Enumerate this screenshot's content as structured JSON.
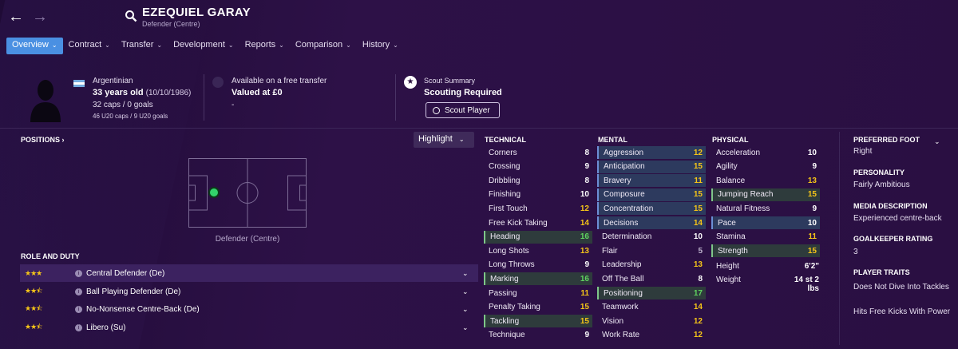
{
  "header": {
    "name": "EZEQUIEL GARAY",
    "position": "Defender (Centre)"
  },
  "tabs": [
    {
      "label": "Overview",
      "active": true
    },
    {
      "label": "Contract"
    },
    {
      "label": "Transfer"
    },
    {
      "label": "Development"
    },
    {
      "label": "Reports"
    },
    {
      "label": "Comparison"
    },
    {
      "label": "History"
    }
  ],
  "info": {
    "nationality": "Argentinian",
    "age": "33 years old",
    "dob": "(10/10/1986)",
    "caps": "32 caps / 0 goals",
    "u20_caps": "46 U20 caps / 9 U20 goals",
    "transfer_status": "Available on a free transfer",
    "value": "Valued at £0",
    "transfer_extra": "-",
    "scout_summary_label": "Scout Summary",
    "scout_summary": "Scouting Required",
    "scout_button": "Scout Player"
  },
  "positions": {
    "title": "POSITIONS",
    "highlight_label": "Highlight",
    "pitch_label": "Defender (Centre)"
  },
  "roles": {
    "title": "ROLE AND DUTY",
    "items": [
      {
        "stars": "★★★",
        "name": "Central Defender (De)",
        "selected": true
      },
      {
        "stars": "★★⯪",
        "name": "Ball Playing Defender (De)"
      },
      {
        "stars": "★★⯪",
        "name": "No-Nonsense Centre-Back (De)"
      },
      {
        "stars": "★★⯪",
        "name": "Libero (Su)"
      }
    ]
  },
  "attributes": {
    "technical_title": "TECHNICAL",
    "mental_title": "MENTAL",
    "physical_title": "PHYSICAL",
    "technical": [
      {
        "name": "Corners",
        "value": "8",
        "color": "white"
      },
      {
        "name": "Crossing",
        "value": "9",
        "color": "white"
      },
      {
        "name": "Dribbling",
        "value": "8",
        "color": "white"
      },
      {
        "name": "Finishing",
        "value": "10",
        "color": "white"
      },
      {
        "name": "First Touch",
        "value": "12",
        "color": "yellow"
      },
      {
        "name": "Free Kick Taking",
        "value": "14",
        "color": "yellow"
      },
      {
        "name": "Heading",
        "value": "16",
        "color": "green",
        "hl": "green"
      },
      {
        "name": "Long Shots",
        "value": "13",
        "color": "yellow"
      },
      {
        "name": "Long Throws",
        "value": "9",
        "color": "white"
      },
      {
        "name": "Marking",
        "value": "16",
        "color": "green",
        "hl": "green"
      },
      {
        "name": "Passing",
        "value": "11",
        "color": "yellow"
      },
      {
        "name": "Penalty Taking",
        "value": "15",
        "color": "yellow"
      },
      {
        "name": "Tackling",
        "value": "15",
        "color": "yellow",
        "hl": "green"
      },
      {
        "name": "Technique",
        "value": "9",
        "color": "white"
      }
    ],
    "mental": [
      {
        "name": "Aggression",
        "value": "12",
        "color": "yellow",
        "hl": "blue"
      },
      {
        "name": "Anticipation",
        "value": "15",
        "color": "yellow",
        "hl": "blue"
      },
      {
        "name": "Bravery",
        "value": "11",
        "color": "yellow",
        "hl": "blue"
      },
      {
        "name": "Composure",
        "value": "15",
        "color": "yellow",
        "hl": "blue"
      },
      {
        "name": "Concentration",
        "value": "15",
        "color": "yellow",
        "hl": "blue"
      },
      {
        "name": "Decisions",
        "value": "14",
        "color": "yellow",
        "hl": "blue"
      },
      {
        "name": "Determination",
        "value": "10",
        "color": "white"
      },
      {
        "name": "Flair",
        "value": "5",
        "color": "gray"
      },
      {
        "name": "Leadership",
        "value": "13",
        "color": "yellow"
      },
      {
        "name": "Off The Ball",
        "value": "8",
        "color": "white"
      },
      {
        "name": "Positioning",
        "value": "17",
        "color": "green",
        "hl": "green"
      },
      {
        "name": "Teamwork",
        "value": "14",
        "color": "yellow"
      },
      {
        "name": "Vision",
        "value": "12",
        "color": "yellow"
      },
      {
        "name": "Work Rate",
        "value": "12",
        "color": "yellow"
      }
    ],
    "physical": [
      {
        "name": "Acceleration",
        "value": "10",
        "color": "white"
      },
      {
        "name": "Agility",
        "value": "9",
        "color": "white"
      },
      {
        "name": "Balance",
        "value": "13",
        "color": "yellow"
      },
      {
        "name": "Jumping Reach",
        "value": "15",
        "color": "yellow",
        "hl": "green"
      },
      {
        "name": "Natural Fitness",
        "value": "9",
        "color": "white"
      },
      {
        "name": "Pace",
        "value": "10",
        "color": "white",
        "hl": "blue"
      },
      {
        "name": "Stamina",
        "value": "11",
        "color": "yellow"
      },
      {
        "name": "Strength",
        "value": "15",
        "color": "yellow",
        "hl": "green"
      }
    ],
    "height_label": "Height",
    "height": "6'2\"",
    "weight_label": "Weight",
    "weight": "14 st 2 lbs"
  },
  "side": {
    "foot_title": "PREFERRED FOOT",
    "foot": "Right",
    "personality_title": "PERSONALITY",
    "personality": "Fairly Ambitious",
    "media_title": "MEDIA DESCRIPTION",
    "media": "Experienced centre-back",
    "gk_title": "GOALKEEPER RATING",
    "gk": "3",
    "traits_title": "PLAYER TRAITS",
    "trait1": "Does Not Dive Into Tackles",
    "trait2": "Hits Free Kicks With Power"
  },
  "colors": {
    "accent": "#4a90e2",
    "yellow": "#f5c518",
    "green": "#5fd35f",
    "bg": "#2a1040"
  }
}
